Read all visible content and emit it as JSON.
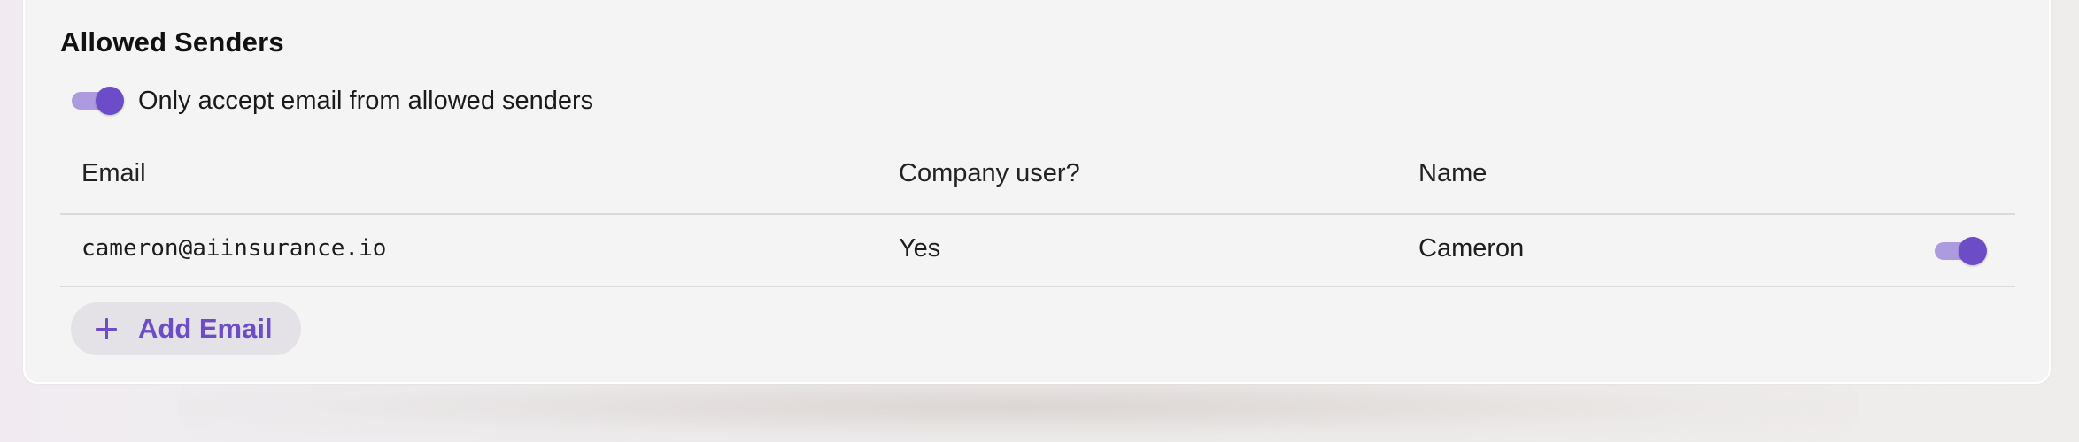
{
  "section": {
    "title": "Allowed Senders"
  },
  "allowlist_toggle": {
    "label": "Only accept email from allowed senders",
    "checked": true
  },
  "table": {
    "columns": [
      "Email",
      "Company user?",
      "Name"
    ],
    "rows": [
      {
        "email": "cameron@aiinsurance.io",
        "company_user": "Yes",
        "name": "Cameron",
        "enabled": true
      }
    ]
  },
  "add_button": {
    "label": "Add Email",
    "icon": "plus-icon"
  },
  "colors": {
    "accent": "#6c4cc7",
    "accent_light": "#ad9be0",
    "card_background": "#f5f4f4",
    "button_background": "#e4e2e6",
    "divider": "#dadada"
  }
}
